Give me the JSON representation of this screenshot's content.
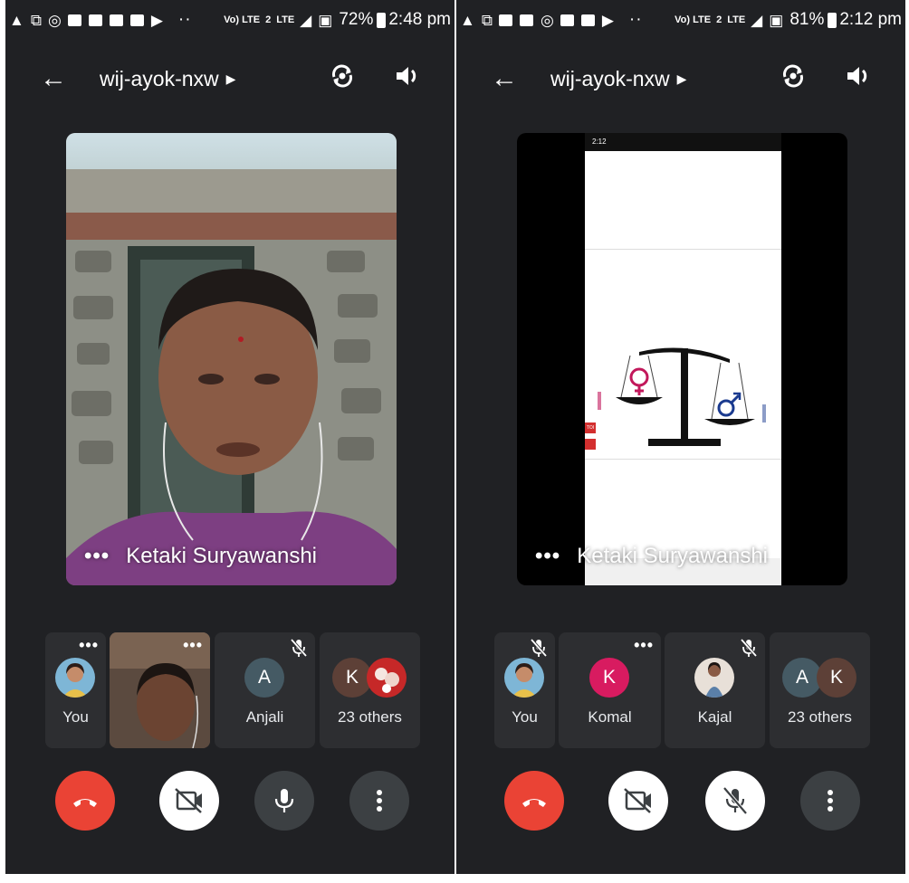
{
  "screens": [
    {
      "status": {
        "battery": "72%",
        "time": "2:48 pm",
        "network": "Vo) LTE",
        "sim": "2",
        "lte": "LTE"
      },
      "meeting_code": "wij-ayok-nxw",
      "main_tile": {
        "name": "Ketaki Suryawanshi"
      },
      "participants": [
        {
          "label": "You",
          "initial": "",
          "muted": false,
          "more": true
        },
        {
          "label": "",
          "initial": "",
          "muted": false,
          "more": true
        },
        {
          "label": "Anjali",
          "initial": "A",
          "muted": true,
          "more": false
        },
        {
          "label": "23 others",
          "initials": [
            "K",
            ""
          ],
          "muted": false,
          "more": false
        }
      ]
    },
    {
      "status": {
        "battery": "81%",
        "time": "2:12 pm",
        "network": "Vo) LTE",
        "sim": "2",
        "lte": "LTE"
      },
      "meeting_code": "wij-ayok-nxw",
      "main_tile": {
        "name": "Ketaki Suryawanshi",
        "shared_status_time": "2:12",
        "shared_logo": "TOI"
      },
      "participants": [
        {
          "label": "You",
          "initial": "",
          "muted": true,
          "more": false
        },
        {
          "label": "Komal",
          "initial": "K",
          "muted": false,
          "more": true
        },
        {
          "label": "Kajal",
          "initial": "",
          "muted": true,
          "more": false
        },
        {
          "label": "23 others",
          "initials": [
            "A",
            "K"
          ],
          "muted": false,
          "more": false
        }
      ]
    }
  ],
  "colors": {
    "background": "#202124",
    "tile": "#2d2e31",
    "end_call": "#ea4335",
    "avatar_anjali": "#455a64",
    "avatar_komal": "#d81b60",
    "avatar_k_brown": "#5d4037",
    "avatar_a_slate": "#455a64"
  },
  "icons": [
    "warning-icon",
    "cast-icon",
    "whatsapp-icon",
    "facebook-icon",
    "folder-icon",
    "gallery-icon",
    "youtube-icon",
    "back-arrow-icon",
    "switch-camera-icon",
    "speaker-icon",
    "more-icon",
    "mic-off-icon",
    "end-call-icon",
    "camera-off-icon",
    "mic-icon",
    "more-vert-icon"
  ]
}
